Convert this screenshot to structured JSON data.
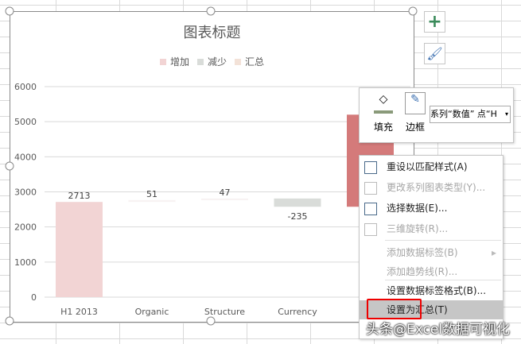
{
  "chart": {
    "title": "图表标题",
    "legend": [
      {
        "label": "增加",
        "color": "#f2d4d4"
      },
      {
        "label": "减少",
        "color": "#d9dcd9"
      },
      {
        "label": "汇总",
        "color": "#f3e2d8"
      }
    ]
  },
  "chart_data": {
    "type": "bar",
    "subtype": "waterfall",
    "title": "图表标题",
    "ylim": [
      0,
      6000
    ],
    "yticks": [
      0,
      1000,
      2000,
      3000,
      4000,
      5000,
      6000
    ],
    "categories": [
      "H1 2013",
      "Organic",
      "Structure",
      "Currency",
      "H"
    ],
    "values": [
      2713,
      51,
      47,
      -235,
      null
    ],
    "labels": [
      "2713",
      "51",
      "47",
      "-235",
      ""
    ],
    "bars": [
      {
        "from": 0,
        "to": 2713,
        "color": "#f2d4d4"
      },
      {
        "from": 2713,
        "to": 2764,
        "color": "#f7f2f2"
      },
      {
        "from": 2764,
        "to": 2811,
        "color": "#f7f2f2"
      },
      {
        "from": 2811,
        "to": 2576,
        "color": "#d9dcd9"
      },
      {
        "from": 2576,
        "to": 5200,
        "color": "#d47a7a"
      }
    ]
  },
  "mini_toolbar": {
    "fill": "填充",
    "border": "边框",
    "series_select": "系列“数值” 点“H"
  },
  "menu": [
    {
      "label": "重设以匹配样式(A)",
      "enabled": true,
      "icon": "reset-style-icon"
    },
    {
      "label": "更改系列图表类型(Y)...",
      "enabled": false,
      "icon": "chart-type-icon"
    },
    {
      "label": "选择数据(E)...",
      "enabled": true,
      "icon": "select-data-icon"
    },
    {
      "label": "三维旋转(R)...",
      "enabled": false,
      "icon": "3d-rotate-icon"
    },
    {
      "label": "添加数据标签(B)",
      "enabled": false,
      "icon": ""
    },
    {
      "label": "添加趋势线(R)...",
      "enabled": false,
      "icon": ""
    },
    {
      "label": "设置数据标签格式(B)...",
      "enabled": true,
      "icon": ""
    },
    {
      "label": "设置为汇总(T)",
      "enabled": true,
      "icon": "",
      "highlighted": true
    }
  ],
  "watermark": "头条@Excel数据可视化"
}
